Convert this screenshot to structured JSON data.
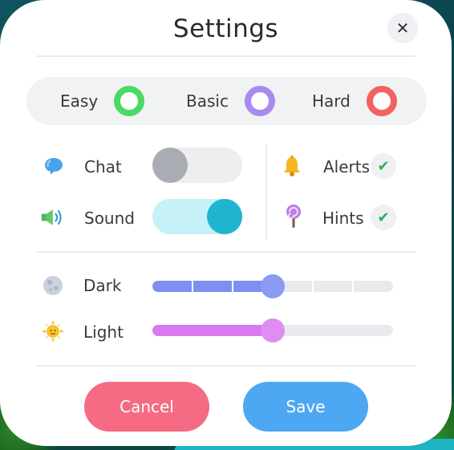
{
  "title": "Settings",
  "difficulty": {
    "options": [
      {
        "label": "Easy",
        "color": "#4cd964"
      },
      {
        "label": "Basic",
        "color": "#a98bf0"
      },
      {
        "label": "Hard",
        "color": "#f26262"
      }
    ]
  },
  "toggles": [
    {
      "label": "Chat",
      "icon": "speech-bubble-icon",
      "on": false
    },
    {
      "label": "Sound",
      "icon": "speaker-icon",
      "on": true
    }
  ],
  "checks": [
    {
      "label": "Alerts",
      "icon": "bell-icon",
      "checked": true,
      "mark": "✔"
    },
    {
      "label": "Hints",
      "icon": "lollipop-icon",
      "checked": true,
      "mark": "✔"
    }
  ],
  "sliders": [
    {
      "label": "Dark",
      "icon": "moon-icon",
      "value": 0.5,
      "color": "#7e8ff2"
    },
    {
      "label": "Light",
      "icon": "sun-icon",
      "value": 0.5,
      "color": "#d879f0"
    }
  ],
  "buttons": {
    "cancel": "Cancel",
    "save": "Save",
    "cancel_color": "#f56b84",
    "save_color": "#4ea7f2"
  },
  "close": "✕"
}
